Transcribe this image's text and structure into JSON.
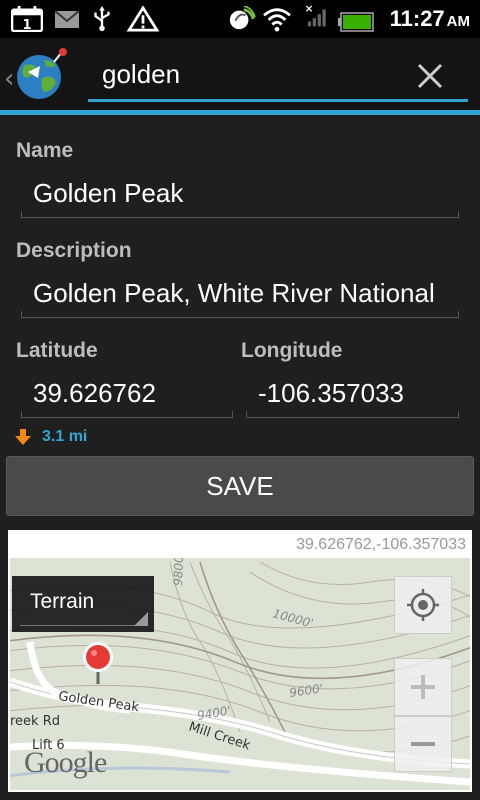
{
  "status_bar": {
    "time": "11:27",
    "ampm": "AM",
    "calendar_day": "1"
  },
  "search": {
    "value": "golden"
  },
  "form": {
    "name_label": "Name",
    "name_value": "Golden Peak",
    "description_label": "Description",
    "description_value": "Golden Peak, White River National",
    "latitude_label": "Latitude",
    "latitude_value": "39.626762",
    "longitude_label": "Longitude",
    "longitude_value": "-106.357033",
    "distance": "3.1 mi",
    "save_label": "SAVE"
  },
  "map": {
    "coords": "39.626762,-106.357033",
    "type_selector": "Terrain",
    "marker_label": "Golden Peak",
    "labels": {
      "contour_9800": "9800",
      "contour_10000": "10000'",
      "contour_9600": "9600'",
      "contour_9400": "9400'",
      "road_creek": "reek Rd",
      "road_mill_creek": "Mill Creek",
      "lift": "Lift 6"
    },
    "attribution": "Google"
  },
  "colors": {
    "accent": "#35a4d0",
    "background": "#1f1f1f",
    "distance_arrow": "#f28a12",
    "marker": "#e53935"
  }
}
